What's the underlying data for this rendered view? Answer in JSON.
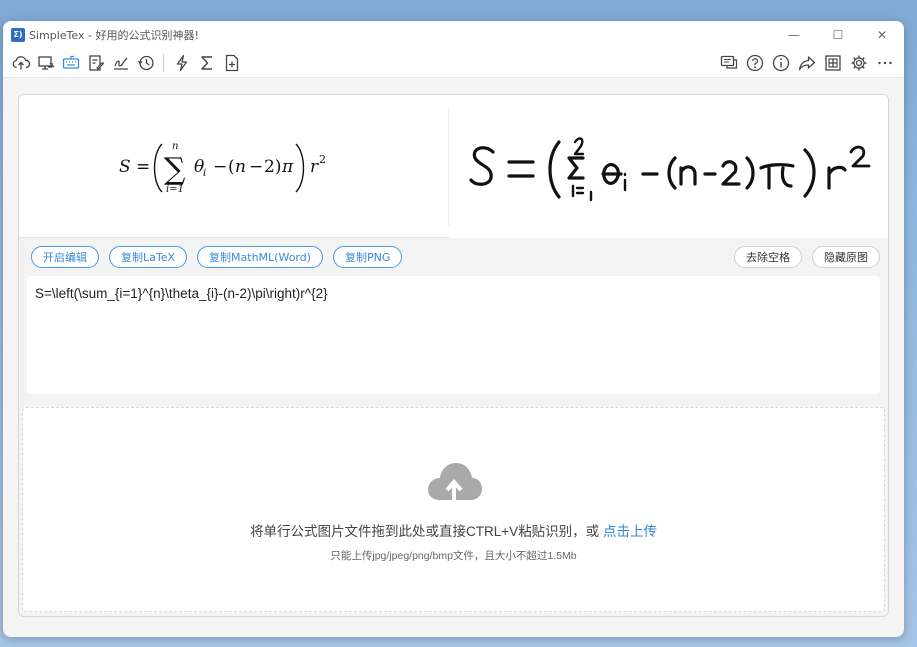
{
  "window": {
    "title": "SimpleTex - 好用的公式识别神器!",
    "logo_text": "Σ)"
  },
  "window_controls": {
    "minimize": "—",
    "maximize": "☐",
    "close": "✕"
  },
  "toolbar_left": [
    {
      "name": "cloud-upload-icon"
    },
    {
      "name": "screen-capture-icon"
    },
    {
      "name": "keyboard-icon",
      "active": true
    },
    {
      "name": "handwrite-icon"
    },
    {
      "name": "sign-icon"
    },
    {
      "name": "history-icon"
    },
    {
      "name": "lightning-icon"
    },
    {
      "name": "sigma-icon"
    },
    {
      "name": "new-doc-icon"
    }
  ],
  "toolbar_right": [
    {
      "name": "feedback-icon"
    },
    {
      "name": "help-icon"
    },
    {
      "name": "info-icon"
    },
    {
      "name": "share-icon"
    },
    {
      "name": "layout-icon"
    },
    {
      "name": "settings-icon"
    },
    {
      "name": "more-icon"
    }
  ],
  "actions": {
    "edit": "开启编辑",
    "copy_latex": "复制LaTeX",
    "copy_mathml": "复制MathML(Word)",
    "copy_png": "复制PNG",
    "remove_spaces": "去除空格",
    "hide_original": "隐藏原图"
  },
  "latex": "S=\\left(\\sum_{i=1}^{n}\\theta_{i}-(n-2)\\pi\\right)r^{2}",
  "drop": {
    "main_text": "将单行公式图片文件拖到此处或直接CTRL+V粘贴识别，或 ",
    "link_text": "点击上传",
    "sub_text": "只能上传jpg/jpeg/png/bmp文件，且大小不超过1.5Mb"
  },
  "colors": {
    "accent": "#3a8ad8",
    "cloud": "#a9a9a9"
  }
}
